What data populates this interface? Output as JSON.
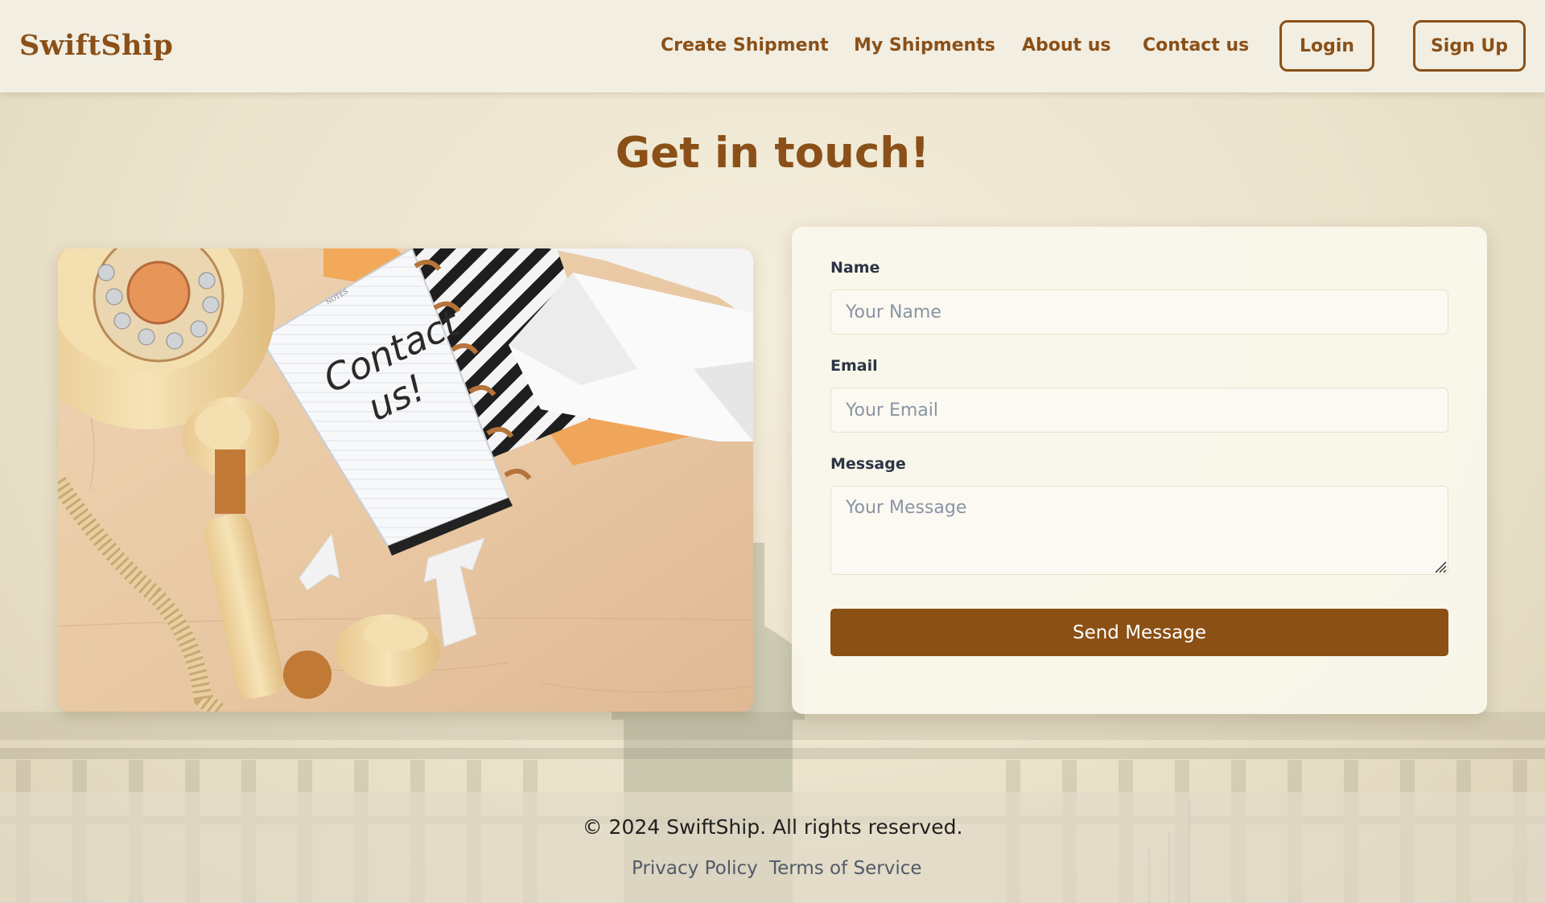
{
  "header": {
    "logo": "SwiftShip",
    "nav": {
      "create_shipment": "Create Shipment",
      "my_shipments": "My Shipments",
      "about_us": "About us",
      "contact_us": "Contact us"
    },
    "login": "Login",
    "signup": "Sign Up"
  },
  "main": {
    "title": "Get in touch!",
    "photo": {
      "note_text_line1": "Contact",
      "note_text_line2": "us!",
      "notebook_header": "NOTES"
    },
    "form": {
      "name_label": "Name",
      "name_placeholder": "Your Name",
      "email_label": "Email",
      "email_placeholder": "Your Email",
      "message_label": "Message",
      "message_placeholder": "Your Message",
      "submit": "Send Message"
    }
  },
  "footer": {
    "copyright": "© 2024 SwiftShip. All rights reserved.",
    "privacy": "Privacy Policy",
    "terms": "Terms of Service"
  },
  "colors": {
    "brand": "#8a5018",
    "button": "#8a5014",
    "label": "#2c3444"
  }
}
